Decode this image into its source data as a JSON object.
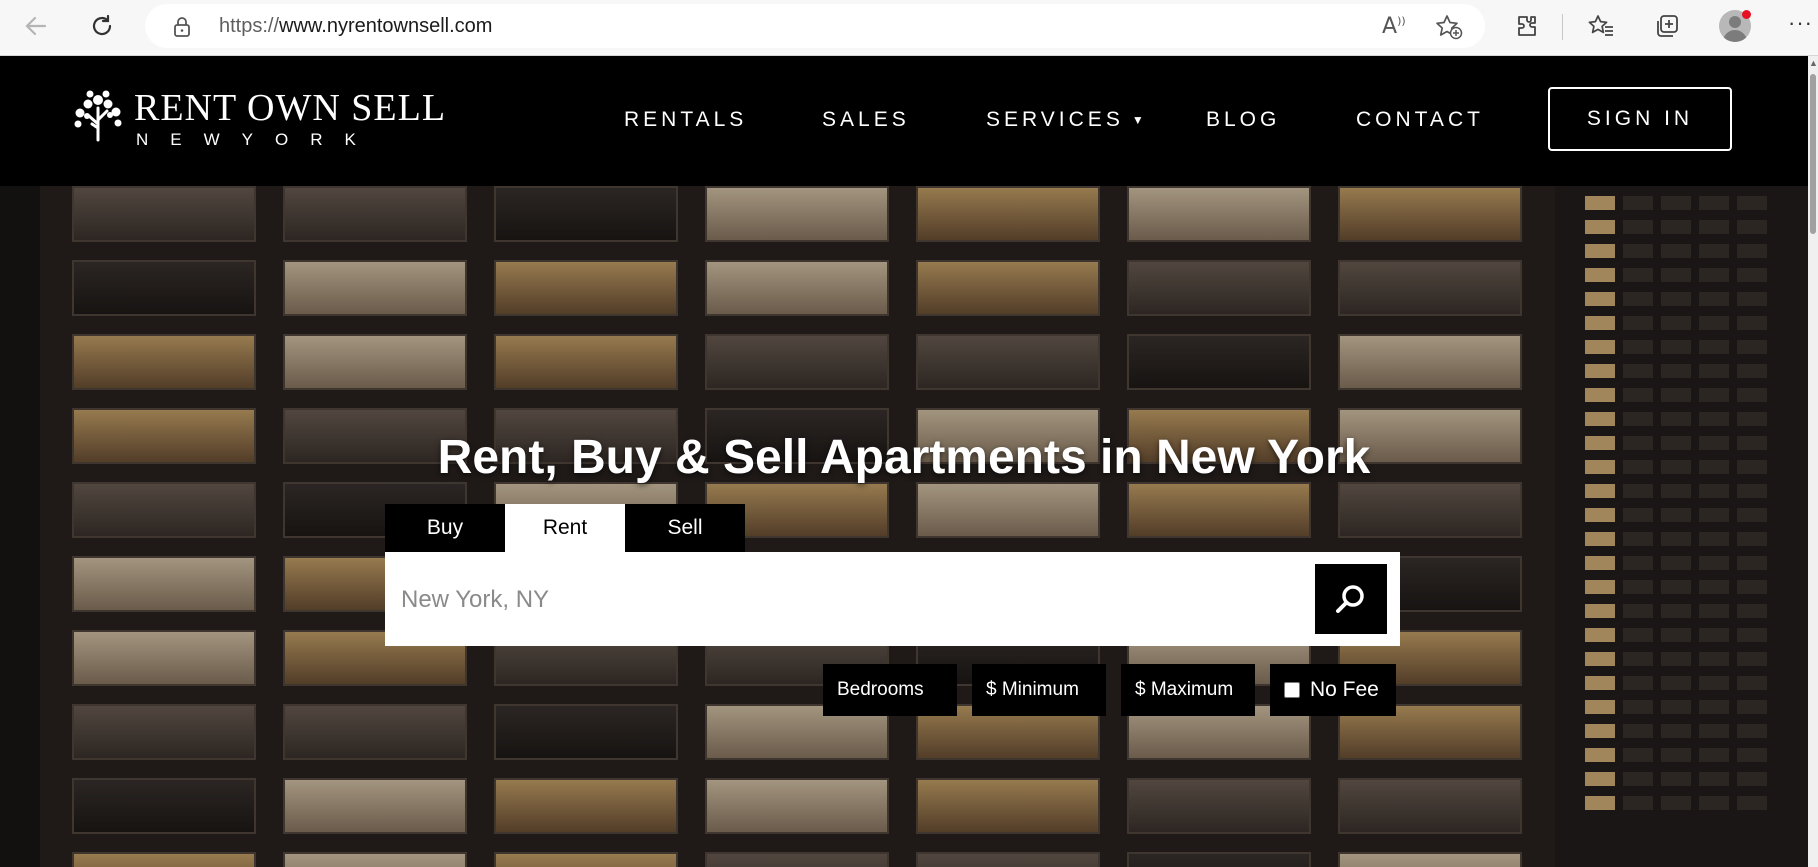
{
  "browser": {
    "url_protocol": "https://",
    "url_host": "www.nyrentownsell.com",
    "read_aloud_label": "A",
    "more_label": "···"
  },
  "site": {
    "logo_main": "RENT OWN SELL",
    "logo_sub": "NEWYORK",
    "nav": {
      "rentals": "RENTALS",
      "sales": "SALES",
      "services": "SERVICES",
      "blog": "BLOG",
      "contact": "CONTACT"
    },
    "signin_label": "SIGN IN"
  },
  "hero": {
    "title": "Rent, Buy & Sell Apartments in New York",
    "tabs": {
      "buy": "Buy",
      "rent": "Rent",
      "sell": "Sell"
    },
    "active_tab": "Rent",
    "search_placeholder": "New York, NY",
    "filters": {
      "bedrooms": "Bedrooms",
      "minimum": "$ Minimum",
      "maximum": "$ Maximum",
      "no_fee": "No Fee"
    }
  },
  "colors": {
    "header_bg": "#000000",
    "accent_red": "#e81123"
  }
}
